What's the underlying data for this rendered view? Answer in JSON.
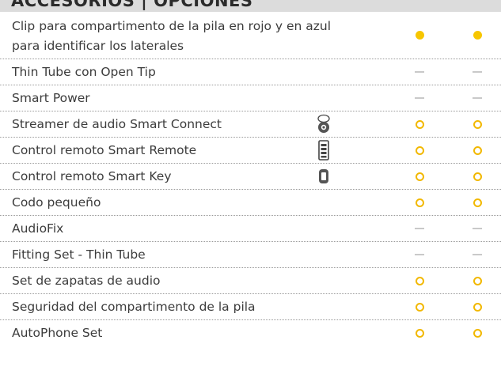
{
  "header": {
    "title": "ACCESORIOS | OPCIONES"
  },
  "legend_symbols": {
    "standard": "filled-dot",
    "optional": "ring",
    "not_available": "dash",
    "colors": {
      "symbol": "#f7c600",
      "dash": "#c9c9c9"
    }
  },
  "rows": [
    {
      "label": "Clip para compartimento de la pila en rojo y en azul para identificar los laterales",
      "icon": null,
      "marks": [
        "standard",
        "standard"
      ]
    },
    {
      "label": "Thin Tube con Open Tip",
      "icon": null,
      "marks": [
        "not_available",
        "not_available"
      ]
    },
    {
      "label": "Smart Power",
      "icon": null,
      "marks": [
        "not_available",
        "not_available"
      ]
    },
    {
      "label": "Streamer de audio Smart Connect",
      "icon": "streamer-device-icon",
      "marks": [
        "optional",
        "optional"
      ]
    },
    {
      "label": "Control remoto Smart Remote",
      "icon": "remote-control-icon",
      "marks": [
        "optional",
        "optional"
      ]
    },
    {
      "label": "Control remoto Smart Key",
      "icon": "key-fob-icon",
      "marks": [
        "optional",
        "optional"
      ]
    },
    {
      "label": "Codo pequeño",
      "icon": null,
      "marks": [
        "optional",
        "optional"
      ]
    },
    {
      "label": "AudioFix",
      "icon": null,
      "marks": [
        "not_available",
        "not_available"
      ]
    },
    {
      "label": "Fitting Set - Thin Tube",
      "icon": null,
      "marks": [
        "not_available",
        "not_available"
      ]
    },
    {
      "label": "Set de zapatas de audio",
      "icon": null,
      "marks": [
        "optional",
        "optional"
      ]
    },
    {
      "label": "Seguridad del compartimento de la pila",
      "icon": null,
      "marks": [
        "optional",
        "optional"
      ]
    },
    {
      "label": "AutoPhone Set",
      "icon": null,
      "marks": [
        "optional",
        "optional"
      ]
    }
  ]
}
